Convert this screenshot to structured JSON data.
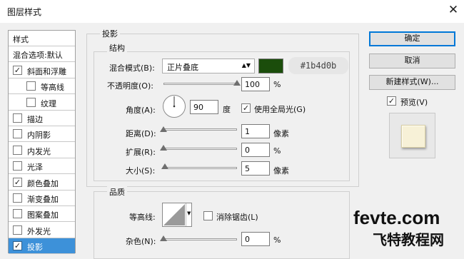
{
  "window": {
    "title": "图层样式"
  },
  "sidebar": {
    "items": [
      {
        "label": "样式",
        "checkbox": false,
        "checked": false,
        "indent": false,
        "selected": false
      },
      {
        "label": "混合选项:默认",
        "checkbox": false,
        "checked": false,
        "indent": false,
        "selected": false
      },
      {
        "label": "斜面和浮雕",
        "checkbox": true,
        "checked": true,
        "indent": false,
        "selected": false
      },
      {
        "label": "等高线",
        "checkbox": true,
        "checked": false,
        "indent": true,
        "selected": false
      },
      {
        "label": "纹理",
        "checkbox": true,
        "checked": false,
        "indent": true,
        "selected": false
      },
      {
        "label": "描边",
        "checkbox": true,
        "checked": false,
        "indent": false,
        "selected": false
      },
      {
        "label": "内阴影",
        "checkbox": true,
        "checked": false,
        "indent": false,
        "selected": false
      },
      {
        "label": "内发光",
        "checkbox": true,
        "checked": false,
        "indent": false,
        "selected": false
      },
      {
        "label": "光泽",
        "checkbox": true,
        "checked": false,
        "indent": false,
        "selected": false
      },
      {
        "label": "颜色叠加",
        "checkbox": true,
        "checked": true,
        "indent": false,
        "selected": false
      },
      {
        "label": "渐变叠加",
        "checkbox": true,
        "checked": false,
        "indent": false,
        "selected": false
      },
      {
        "label": "图案叠加",
        "checkbox": true,
        "checked": false,
        "indent": false,
        "selected": false
      },
      {
        "label": "外发光",
        "checkbox": true,
        "checked": false,
        "indent": false,
        "selected": false
      },
      {
        "label": "投影",
        "checkbox": true,
        "checked": true,
        "indent": false,
        "selected": true
      }
    ]
  },
  "drop_shadow": {
    "section_title": "投影",
    "structure_title": "结构",
    "blend_mode": {
      "label": "混合模式(B):",
      "value": "正片叠底"
    },
    "color": "#1b4d0b",
    "color_hex_label": "#1b4d0b",
    "opacity": {
      "label": "不透明度(O):",
      "value": "100",
      "unit": "%",
      "fraction": 1.0
    },
    "angle": {
      "label": "角度(A):",
      "value": "90",
      "unit": "度"
    },
    "global_light": {
      "label": "使用全局光(G)",
      "checked": true
    },
    "distance": {
      "label": "距离(D):",
      "value": "1",
      "unit": "像素",
      "fraction": 0.0
    },
    "spread": {
      "label": "扩展(R):",
      "value": "0",
      "unit": "%",
      "fraction": 0.0
    },
    "size": {
      "label": "大小(S):",
      "value": "5",
      "unit": "像素",
      "fraction": 0.02
    },
    "quality_title": "品质",
    "contour": {
      "label": "等高线:"
    },
    "anti_alias": {
      "label": "消除锯齿(L)",
      "checked": false
    },
    "noise": {
      "label": "杂色(N):",
      "value": "0",
      "unit": "%",
      "fraction": 0.0
    }
  },
  "buttons": {
    "ok": "确定",
    "cancel": "取消",
    "new_style": "新建样式(W)..."
  },
  "preview": {
    "label": "预览(V)",
    "checked": true
  },
  "watermark": {
    "line1": "fevte.com",
    "line2": "飞特教程网"
  }
}
